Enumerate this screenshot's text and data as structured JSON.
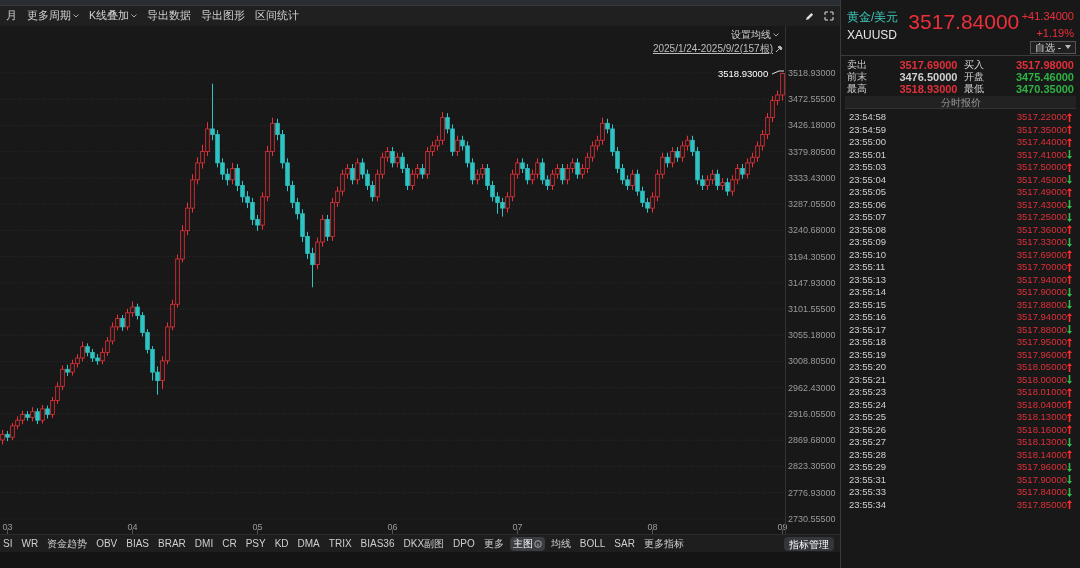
{
  "toolbar": {
    "items": [
      {
        "label": "月",
        "dropdown": false
      },
      {
        "label": "更多周期",
        "dropdown": true
      },
      {
        "label": "K线叠加",
        "dropdown": true
      },
      {
        "label": "导出数据",
        "dropdown": false
      },
      {
        "label": "导出图形",
        "dropdown": false
      },
      {
        "label": "区间统计",
        "dropdown": false
      }
    ]
  },
  "chart": {
    "ma_setting": "设置均线",
    "date_range": "2025/1/24-2025/9/2(157根)",
    "max_label": "3518.93000",
    "chart_data": {
      "type": "candlestick",
      "ylim": [
        2703.8,
        3602
      ],
      "grid": true,
      "categories": [
        null,
        "03",
        null,
        null,
        null,
        null,
        null,
        null,
        null,
        null,
        null,
        null,
        null,
        null,
        null,
        null,
        null,
        null,
        null,
        null,
        null,
        null,
        null,
        null,
        null,
        null,
        "04",
        null,
        null,
        null,
        null,
        null,
        null,
        null,
        null,
        null,
        null,
        null,
        null,
        null,
        null,
        null,
        null,
        null,
        null,
        null,
        null,
        null,
        null,
        null,
        null,
        "05",
        null,
        null,
        null,
        null,
        null,
        null,
        null,
        null,
        null,
        null,
        null,
        null,
        null,
        null,
        null,
        null,
        null,
        null,
        null,
        null,
        null,
        null,
        null,
        null,
        null,
        null,
        "06",
        null,
        null,
        null,
        null,
        null,
        null,
        null,
        null,
        null,
        null,
        null,
        null,
        null,
        null,
        null,
        null,
        null,
        null,
        null,
        null,
        null,
        null,
        null,
        null,
        "07",
        null,
        null,
        null,
        null,
        null,
        null,
        null,
        null,
        null,
        null,
        null,
        null,
        null,
        null,
        null,
        null,
        null,
        null,
        null,
        null,
        null,
        null,
        null,
        null,
        null,
        null,
        "08",
        null,
        null,
        null,
        null,
        null,
        null,
        null,
        null,
        null,
        null,
        null,
        null,
        null,
        null,
        null,
        null,
        null,
        null,
        null,
        null,
        null,
        null,
        null,
        null,
        null,
        "09"
      ],
      "yticks": [
        {
          "value": 3518.93,
          "label": "3518.93000"
        },
        {
          "value": 3472.555,
          "label": "3472.55500"
        },
        {
          "value": 3426.18,
          "label": "3426.18000"
        },
        {
          "value": 3379.805,
          "label": "3379.80500"
        },
        {
          "value": 3333.43,
          "label": "3333.43000"
        },
        {
          "value": 3287.055,
          "label": "3287.05500"
        },
        {
          "value": 3240.68,
          "label": "3240.68000"
        },
        {
          "value": 3194.305,
          "label": "3194.30500"
        },
        {
          "value": 3147.93,
          "label": "3147.93000"
        },
        {
          "value": 3101.555,
          "label": "3101.55500"
        },
        {
          "value": 3055.18,
          "label": "3055.18000"
        },
        {
          "value": 3008.805,
          "label": "3008.80500"
        },
        {
          "value": 2962.43,
          "label": "2962.43000"
        },
        {
          "value": 2916.055,
          "label": "2916.05500"
        },
        {
          "value": 2869.68,
          "label": "2869.68000"
        },
        {
          "value": 2823.305,
          "label": "2823.30500"
        },
        {
          "value": 2776.93,
          "label": "2776.93000"
        },
        {
          "value": 2730.555,
          "label": "2730.55500"
        }
      ],
      "ohlc": [
        [
          2870,
          2888,
          2862,
          2880
        ],
        [
          2880,
          2886,
          2868,
          2875
        ],
        [
          2875,
          2900,
          2870,
          2895
        ],
        [
          2895,
          2912,
          2889,
          2905
        ],
        [
          2905,
          2922,
          2898,
          2915
        ],
        [
          2915,
          2921,
          2904,
          2910
        ],
        [
          2910,
          2928,
          2903,
          2920
        ],
        [
          2920,
          2926,
          2898,
          2905
        ],
        [
          2905,
          2932,
          2899,
          2925
        ],
        [
          2925,
          2931,
          2908,
          2915
        ],
        [
          2915,
          2946,
          2909,
          2940
        ],
        [
          2940,
          2972,
          2934,
          2965
        ],
        [
          2965,
          3002,
          2958,
          2995
        ],
        [
          2995,
          3003,
          2983,
          2990
        ],
        [
          2990,
          3012,
          2984,
          3005
        ],
        [
          3005,
          3022,
          2998,
          3015
        ],
        [
          3015,
          3044,
          3009,
          3035
        ],
        [
          3035,
          3041,
          3018,
          3025
        ],
        [
          3025,
          3031,
          3008,
          3015
        ],
        [
          3015,
          3022,
          3003,
          3010
        ],
        [
          3010,
          3033,
          3004,
          3025
        ],
        [
          3025,
          3052,
          3019,
          3045
        ],
        [
          3045,
          3078,
          3039,
          3070
        ],
        [
          3070,
          3092,
          3064,
          3085
        ],
        [
          3085,
          3091,
          3063,
          3070
        ],
        [
          3070,
          3102,
          3064,
          3095
        ],
        [
          3095,
          3115,
          3088,
          3105
        ],
        [
          3105,
          3111,
          3083,
          3090
        ],
        [
          3090,
          3096,
          3053,
          3060
        ],
        [
          3060,
          3066,
          3023,
          3030
        ],
        [
          3030,
          3036,
          2975,
          2990
        ],
        [
          2990,
          3000,
          2950,
          2975
        ],
        [
          2975,
          3018,
          2960,
          3010
        ],
        [
          3010,
          3078,
          3004,
          3070
        ],
        [
          3070,
          3118,
          3064,
          3110
        ],
        [
          3110,
          3198,
          3104,
          3190
        ],
        [
          3190,
          3250,
          3184,
          3240
        ],
        [
          3240,
          3290,
          3232,
          3280
        ],
        [
          3280,
          3340,
          3272,
          3330
        ],
        [
          3330,
          3370,
          3322,
          3360
        ],
        [
          3360,
          3392,
          3350,
          3380
        ],
        [
          3380,
          3432,
          3372,
          3420
        ],
        [
          3420,
          3500,
          3400,
          3410
        ],
        [
          3410,
          3418,
          3352,
          3360
        ],
        [
          3360,
          3368,
          3330,
          3340
        ],
        [
          3340,
          3350,
          3320,
          3330
        ],
        [
          3330,
          3360,
          3322,
          3350
        ],
        [
          3350,
          3358,
          3310,
          3320
        ],
        [
          3320,
          3328,
          3290,
          3300
        ],
        [
          3300,
          3310,
          3280,
          3290
        ],
        [
          3290,
          3298,
          3250,
          3260
        ],
        [
          3260,
          3268,
          3240,
          3250
        ],
        [
          3250,
          3308,
          3242,
          3300
        ],
        [
          3300,
          3390,
          3292,
          3380
        ],
        [
          3380,
          3440,
          3372,
          3430
        ],
        [
          3430,
          3438,
          3400,
          3410
        ],
        [
          3410,
          3418,
          3350,
          3360
        ],
        [
          3360,
          3368,
          3310,
          3320
        ],
        [
          3320,
          3328,
          3280,
          3290
        ],
        [
          3290,
          3298,
          3260,
          3270
        ],
        [
          3270,
          3278,
          3220,
          3230
        ],
        [
          3230,
          3238,
          3190,
          3200
        ],
        [
          3200,
          3210,
          3140,
          3180
        ],
        [
          3180,
          3228,
          3172,
          3220
        ],
        [
          3220,
          3268,
          3212,
          3260
        ],
        [
          3260,
          3268,
          3222,
          3230
        ],
        [
          3230,
          3298,
          3222,
          3290
        ],
        [
          3290,
          3318,
          3282,
          3310
        ],
        [
          3310,
          3348,
          3302,
          3340
        ],
        [
          3340,
          3358,
          3332,
          3350
        ],
        [
          3350,
          3358,
          3322,
          3330
        ],
        [
          3330,
          3368,
          3322,
          3360
        ],
        [
          3360,
          3368,
          3332,
          3340
        ],
        [
          3340,
          3348,
          3312,
          3320
        ],
        [
          3320,
          3328,
          3292,
          3300
        ],
        [
          3300,
          3348,
          3292,
          3340
        ],
        [
          3340,
          3378,
          3332,
          3370
        ],
        [
          3370,
          3388,
          3362,
          3380
        ],
        [
          3380,
          3388,
          3352,
          3360
        ],
        [
          3360,
          3378,
          3352,
          3370
        ],
        [
          3370,
          3378,
          3342,
          3350
        ],
        [
          3350,
          3358,
          3312,
          3320
        ],
        [
          3320,
          3348,
          3312,
          3340
        ],
        [
          3340,
          3358,
          3332,
          3350
        ],
        [
          3350,
          3358,
          3332,
          3340
        ],
        [
          3340,
          3388,
          3332,
          3380
        ],
        [
          3380,
          3398,
          3372,
          3390
        ],
        [
          3390,
          3408,
          3382,
          3400
        ],
        [
          3400,
          3450,
          3392,
          3440
        ],
        [
          3440,
          3448,
          3412,
          3420
        ],
        [
          3420,
          3428,
          3372,
          3380
        ],
        [
          3380,
          3408,
          3372,
          3400
        ],
        [
          3400,
          3408,
          3382,
          3390
        ],
        [
          3390,
          3398,
          3352,
          3360
        ],
        [
          3360,
          3368,
          3322,
          3330
        ],
        [
          3330,
          3348,
          3322,
          3340
        ],
        [
          3340,
          3358,
          3332,
          3350
        ],
        [
          3350,
          3358,
          3312,
          3320
        ],
        [
          3320,
          3328,
          3292,
          3300
        ],
        [
          3300,
          3308,
          3270,
          3290
        ],
        [
          3290,
          3298,
          3265,
          3280
        ],
        [
          3280,
          3308,
          3272,
          3300
        ],
        [
          3300,
          3348,
          3292,
          3340
        ],
        [
          3340,
          3368,
          3332,
          3360
        ],
        [
          3360,
          3368,
          3342,
          3350
        ],
        [
          3350,
          3358,
          3322,
          3330
        ],
        [
          3330,
          3348,
          3322,
          3340
        ],
        [
          3340,
          3368,
          3332,
          3360
        ],
        [
          3360,
          3368,
          3322,
          3330
        ],
        [
          3330,
          3338,
          3312,
          3320
        ],
        [
          3320,
          3348,
          3312,
          3340
        ],
        [
          3340,
          3358,
          3332,
          3350
        ],
        [
          3350,
          3358,
          3322,
          3330
        ],
        [
          3330,
          3358,
          3322,
          3350
        ],
        [
          3350,
          3368,
          3342,
          3360
        ],
        [
          3360,
          3368,
          3332,
          3340
        ],
        [
          3340,
          3358,
          3332,
          3350
        ],
        [
          3350,
          3378,
          3342,
          3370
        ],
        [
          3370,
          3398,
          3362,
          3390
        ],
        [
          3390,
          3408,
          3382,
          3400
        ],
        [
          3400,
          3440,
          3392,
          3430
        ],
        [
          3430,
          3438,
          3412,
          3420
        ],
        [
          3420,
          3428,
          3372,
          3380
        ],
        [
          3380,
          3388,
          3342,
          3350
        ],
        [
          3350,
          3358,
          3322,
          3330
        ],
        [
          3330,
          3338,
          3312,
          3320
        ],
        [
          3320,
          3348,
          3312,
          3340
        ],
        [
          3340,
          3348,
          3302,
          3310
        ],
        [
          3310,
          3318,
          3282,
          3290
        ],
        [
          3290,
          3298,
          3272,
          3280
        ],
        [
          3280,
          3308,
          3272,
          3300
        ],
        [
          3300,
          3348,
          3292,
          3340
        ],
        [
          3340,
          3378,
          3332,
          3370
        ],
        [
          3370,
          3378,
          3352,
          3360
        ],
        [
          3360,
          3388,
          3352,
          3380
        ],
        [
          3380,
          3388,
          3362,
          3370
        ],
        [
          3370,
          3398,
          3362,
          3390
        ],
        [
          3390,
          3408,
          3382,
          3400
        ],
        [
          3400,
          3408,
          3372,
          3380
        ],
        [
          3380,
          3388,
          3322,
          3330
        ],
        [
          3330,
          3338,
          3312,
          3320
        ],
        [
          3320,
          3338,
          3312,
          3330
        ],
        [
          3330,
          3348,
          3322,
          3340
        ],
        [
          3340,
          3348,
          3312,
          3320
        ],
        [
          3320,
          3333,
          3312,
          3325
        ],
        [
          3325,
          3333,
          3302,
          3310
        ],
        [
          3310,
          3338,
          3302,
          3330
        ],
        [
          3330,
          3358,
          3322,
          3350
        ],
        [
          3350,
          3358,
          3332,
          3340
        ],
        [
          3340,
          3368,
          3332,
          3360
        ],
        [
          3360,
          3378,
          3352,
          3370
        ],
        [
          3370,
          3398,
          3362,
          3390
        ],
        [
          3390,
          3418,
          3382,
          3410
        ],
        [
          3410,
          3448,
          3402,
          3440
        ],
        [
          3440,
          3478,
          3432,
          3470
        ],
        [
          3470,
          3488,
          3462,
          3480
        ],
        [
          3480,
          3518.93,
          3470,
          3517.84
        ]
      ]
    }
  },
  "indicators": [
    {
      "label": "SI",
      "selected": false
    },
    {
      "label": "WR",
      "selected": false
    },
    {
      "label": "资金趋势",
      "selected": false
    },
    {
      "label": "OBV",
      "selected": false
    },
    {
      "label": "BIAS",
      "selected": false
    },
    {
      "label": "BRAR",
      "selected": false
    },
    {
      "label": "DMI",
      "selected": false
    },
    {
      "label": "CR",
      "selected": false
    },
    {
      "label": "PSY",
      "selected": false
    },
    {
      "label": "KD",
      "selected": false
    },
    {
      "label": "DMA",
      "selected": false
    },
    {
      "label": "TRIX",
      "selected": false
    },
    {
      "label": "BIAS36",
      "selected": false
    },
    {
      "label": "DKX副图",
      "selected": false
    },
    {
      "label": "DPO",
      "selected": false
    },
    {
      "label": "更多",
      "selected": false
    },
    {
      "label": "主图",
      "selected": true
    },
    {
      "label": "均线",
      "selected": false
    },
    {
      "label": "BOLL",
      "selected": false
    },
    {
      "label": "SAR",
      "selected": false
    },
    {
      "label": "更多指标",
      "selected": false
    }
  ],
  "indicator_manage": "指标管理",
  "quote": {
    "name": "黄金/美元",
    "symbol": "XAUUSD",
    "price": "3517.84000",
    "change": "+41.34000",
    "change_pct": "+1.19%",
    "watchlist": "自选 -",
    "stats": [
      {
        "label": "卖出",
        "value": "3517.69000",
        "color": "#e0303a"
      },
      {
        "label": "买入",
        "value": "3517.98000",
        "color": "#e0303a"
      },
      {
        "label": "前末",
        "value": "3476.50000",
        "color": "#d0d0d0"
      },
      {
        "label": "开盘",
        "value": "3475.46000",
        "color": "#2fb344"
      },
      {
        "label": "最高",
        "value": "3518.93000",
        "color": "#e0303a"
      },
      {
        "label": "最低",
        "value": "3470.35000",
        "color": "#2fb344"
      }
    ],
    "ticks_title": "分时报价",
    "ticks": [
      {
        "time": "23:54:58",
        "price": "3517.22000",
        "kind": "up"
      },
      {
        "time": "23:54:59",
        "price": "3517.35000",
        "kind": "up"
      },
      {
        "time": "23:55:00",
        "price": "3517.44000",
        "kind": "up"
      },
      {
        "time": "23:55:01",
        "price": "3517.41000",
        "kind": "down"
      },
      {
        "time": "23:55:03",
        "price": "3517.50000",
        "kind": "up"
      },
      {
        "time": "23:55:04",
        "price": "3517.45000",
        "kind": "down"
      },
      {
        "time": "23:55:05",
        "price": "3517.49000",
        "kind": "up"
      },
      {
        "time": "23:55:06",
        "price": "3517.43000",
        "kind": "down"
      },
      {
        "time": "23:55:07",
        "price": "3517.25000",
        "kind": "down"
      },
      {
        "time": "23:55:08",
        "price": "3517.36000",
        "kind": "up"
      },
      {
        "time": "23:55:09",
        "price": "3517.33000",
        "kind": "down"
      },
      {
        "time": "23:55:10",
        "price": "3517.69000",
        "kind": "up"
      },
      {
        "time": "23:55:11",
        "price": "3517.70000",
        "kind": "up"
      },
      {
        "time": "23:55:13",
        "price": "3517.94000",
        "kind": "up"
      },
      {
        "time": "23:55:14",
        "price": "3517.90000",
        "kind": "down"
      },
      {
        "time": "23:55:15",
        "price": "3517.88000",
        "kind": "down"
      },
      {
        "time": "23:55:16",
        "price": "3517.94000",
        "kind": "up"
      },
      {
        "time": "23:55:17",
        "price": "3517.88000",
        "kind": "down"
      },
      {
        "time": "23:55:18",
        "price": "3517.95000",
        "kind": "up"
      },
      {
        "time": "23:55:19",
        "price": "3517.96000",
        "kind": "up"
      },
      {
        "time": "23:55:20",
        "price": "3518.05000",
        "kind": "up"
      },
      {
        "time": "23:55:21",
        "price": "3518.00000",
        "kind": "down"
      },
      {
        "time": "23:55:23",
        "price": "3518.01000",
        "kind": "up"
      },
      {
        "time": "23:55:24",
        "price": "3518.04000",
        "kind": "up"
      },
      {
        "time": "23:55:25",
        "price": "3518.13000",
        "kind": "up"
      },
      {
        "time": "23:55:26",
        "price": "3518.16000",
        "kind": "up"
      },
      {
        "time": "23:55:27",
        "price": "3518.13000",
        "kind": "down"
      },
      {
        "time": "23:55:28",
        "price": "3518.14000",
        "kind": "up"
      },
      {
        "time": "23:55:29",
        "price": "3517.96000",
        "kind": "down"
      },
      {
        "time": "23:55:31",
        "price": "3517.90000",
        "kind": "down"
      },
      {
        "time": "23:55:33",
        "price": "3517.84000",
        "kind": "down"
      },
      {
        "time": "23:55:34",
        "price": "3517.85000",
        "kind": "up"
      }
    ]
  }
}
